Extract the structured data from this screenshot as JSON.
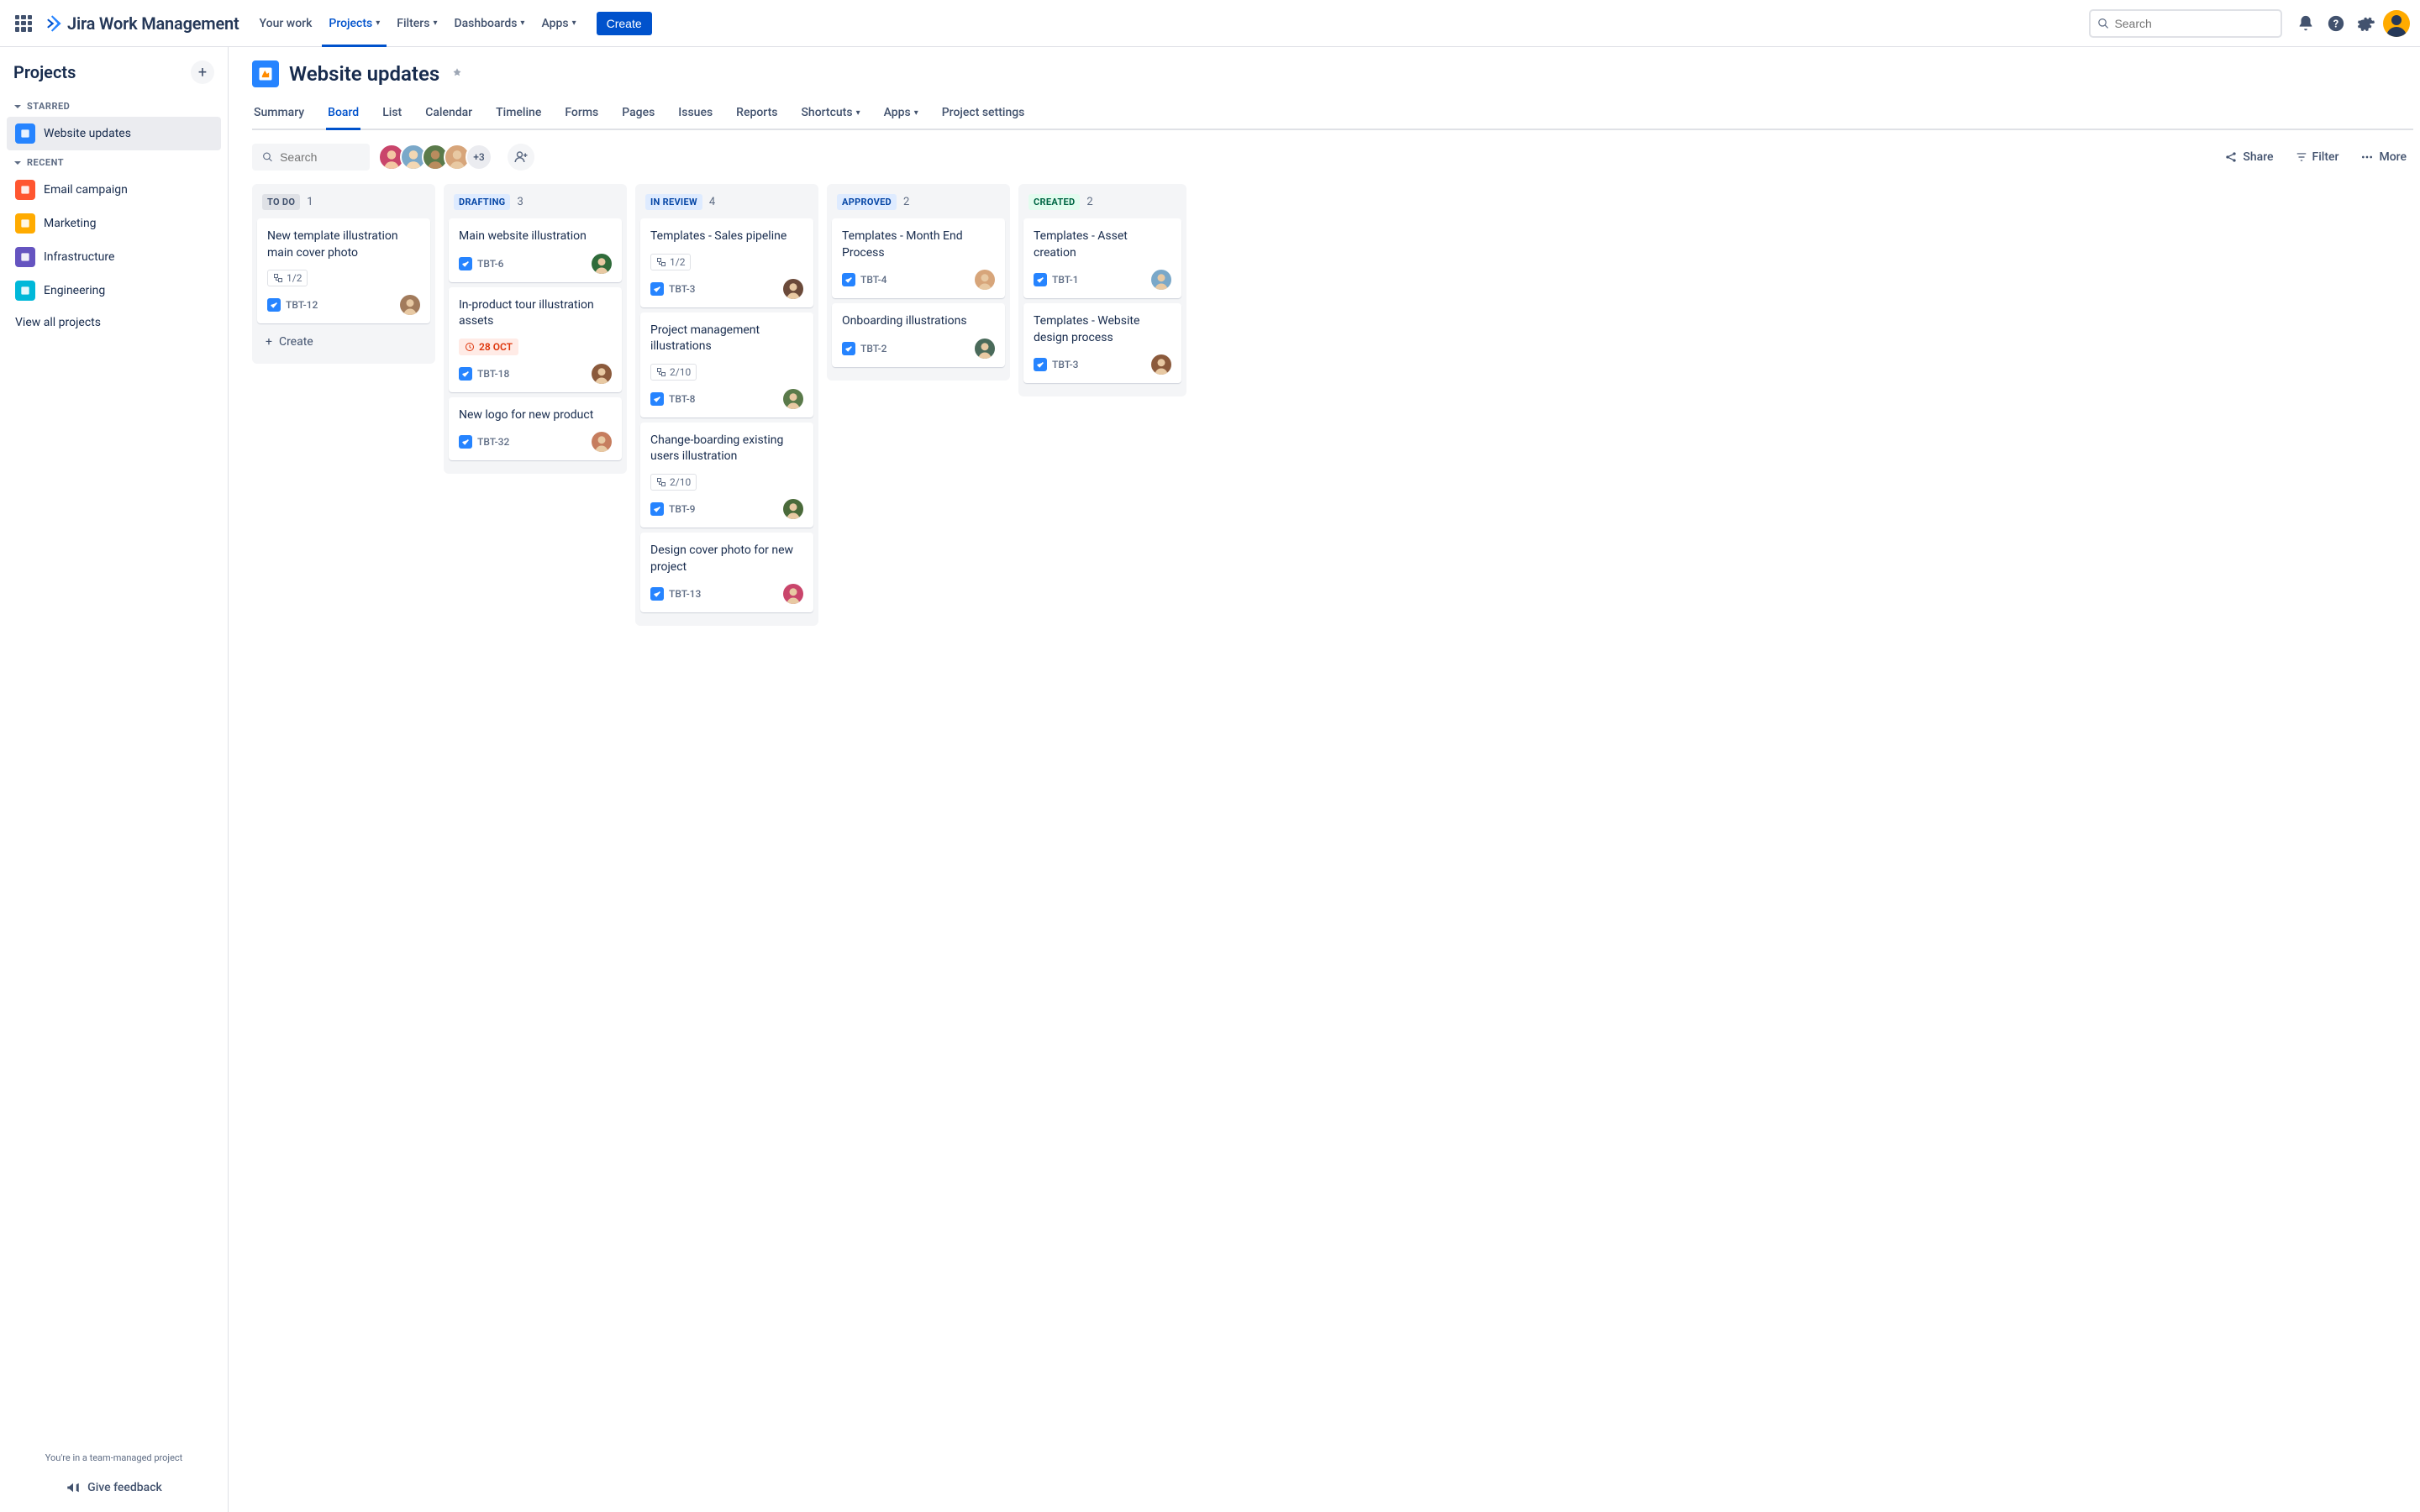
{
  "topnav": {
    "product_name": "Jira Work Management",
    "items": [
      {
        "label": "Your work",
        "has_menu": false,
        "active": false
      },
      {
        "label": "Projects",
        "has_menu": true,
        "active": true
      },
      {
        "label": "Filters",
        "has_menu": true,
        "active": false
      },
      {
        "label": "Dashboards",
        "has_menu": true,
        "active": false
      },
      {
        "label": "Apps",
        "has_menu": true,
        "active": false
      }
    ],
    "create_label": "Create",
    "search_placeholder": "Search"
  },
  "sidebar": {
    "title": "Projects",
    "starred_label": "STARRED",
    "recent_label": "RECENT",
    "starred": [
      {
        "label": "Website updates",
        "bg": "#2684FF"
      }
    ],
    "recent": [
      {
        "label": "Email campaign",
        "bg": "#FF5630"
      },
      {
        "label": "Marketing",
        "bg": "#FFAB00"
      },
      {
        "label": "Infrastructure",
        "bg": "#6554C0"
      },
      {
        "label": "Engineering",
        "bg": "#00B8D9"
      }
    ],
    "view_all": "View all projects",
    "team_managed": "You're in a team-managed project",
    "feedback": "Give feedback"
  },
  "page": {
    "title": "Website updates"
  },
  "tabs": [
    {
      "label": "Summary",
      "active": false,
      "menu": false
    },
    {
      "label": "Board",
      "active": true,
      "menu": false
    },
    {
      "label": "List",
      "active": false,
      "menu": false
    },
    {
      "label": "Calendar",
      "active": false,
      "menu": false
    },
    {
      "label": "Timeline",
      "active": false,
      "menu": false
    },
    {
      "label": "Forms",
      "active": false,
      "menu": false
    },
    {
      "label": "Pages",
      "active": false,
      "menu": false
    },
    {
      "label": "Issues",
      "active": false,
      "menu": false
    },
    {
      "label": "Reports",
      "active": false,
      "menu": false
    },
    {
      "label": "Shortcuts",
      "active": false,
      "menu": true
    },
    {
      "label": "Apps",
      "active": false,
      "menu": true
    },
    {
      "label": "Project settings",
      "active": false,
      "menu": false
    }
  ],
  "toolbar": {
    "search_placeholder": "Search",
    "avatar_overflow": "+3",
    "share": "Share",
    "filter": "Filter",
    "more": "More"
  },
  "columns": [
    {
      "name": "TO DO",
      "count": "1",
      "badge_bg": "#dfe1e6",
      "badge_fg": "#42526E",
      "cards": [
        {
          "title": "New template illustration main cover photo",
          "subtasks": "1/2",
          "key": "TBT-12",
          "avatar": "#a27b5c"
        }
      ],
      "show_create": true,
      "create_label": "Create"
    },
    {
      "name": "DRAFTING",
      "count": "3",
      "badge_bg": "#DEEBFF",
      "badge_fg": "#0747A6",
      "cards": [
        {
          "title": "Main website illustration",
          "key": "TBT-6",
          "avatar": "#2f6b3a"
        },
        {
          "title": "In-product tour illustration assets",
          "date": "28 OCT",
          "key": "TBT-18",
          "avatar": "#8b5a3c"
        },
        {
          "title": "New logo for new product",
          "key": "TBT-32",
          "avatar": "#c67d5e"
        }
      ],
      "show_create": false
    },
    {
      "name": "IN REVIEW",
      "count": "4",
      "badge_bg": "#DEEBFF",
      "badge_fg": "#0747A6",
      "cards": [
        {
          "title": "Templates - Sales pipeline",
          "subtasks": "1/2",
          "key": "TBT-3",
          "avatar": "#6b4a3a"
        },
        {
          "title": "Project management illustrations",
          "subtasks": "2/10",
          "key": "TBT-8",
          "avatar": "#5a7a4a"
        },
        {
          "title": "Change-boarding existing users illustration",
          "subtasks": "2/10",
          "key": "TBT-9",
          "avatar": "#4a6a3a"
        },
        {
          "title": "Design cover photo for new project",
          "key": "TBT-13",
          "avatar": "#c9456b"
        }
      ],
      "show_create": false
    },
    {
      "name": "APPROVED",
      "count": "2",
      "badge_bg": "#DEEBFF",
      "badge_fg": "#0747A6",
      "cards": [
        {
          "title": "Templates - Month End Process",
          "key": "TBT-4",
          "avatar": "#d7a57a"
        },
        {
          "title": "Onboarding illustrations",
          "key": "TBT-2",
          "avatar": "#4a6a5a"
        }
      ],
      "show_create": false
    },
    {
      "name": "CREATED",
      "count": "2",
      "badge_bg": "#E3FCEF",
      "badge_fg": "#006644",
      "cards": [
        {
          "title": "Templates - Asset creation",
          "key": "TBT-1",
          "avatar": "#7aa8c9"
        },
        {
          "title": "Templates - Website design process",
          "key": "TBT-3",
          "avatar": "#8b5a3c"
        }
      ],
      "show_create": false,
      "truncated": true
    }
  ]
}
